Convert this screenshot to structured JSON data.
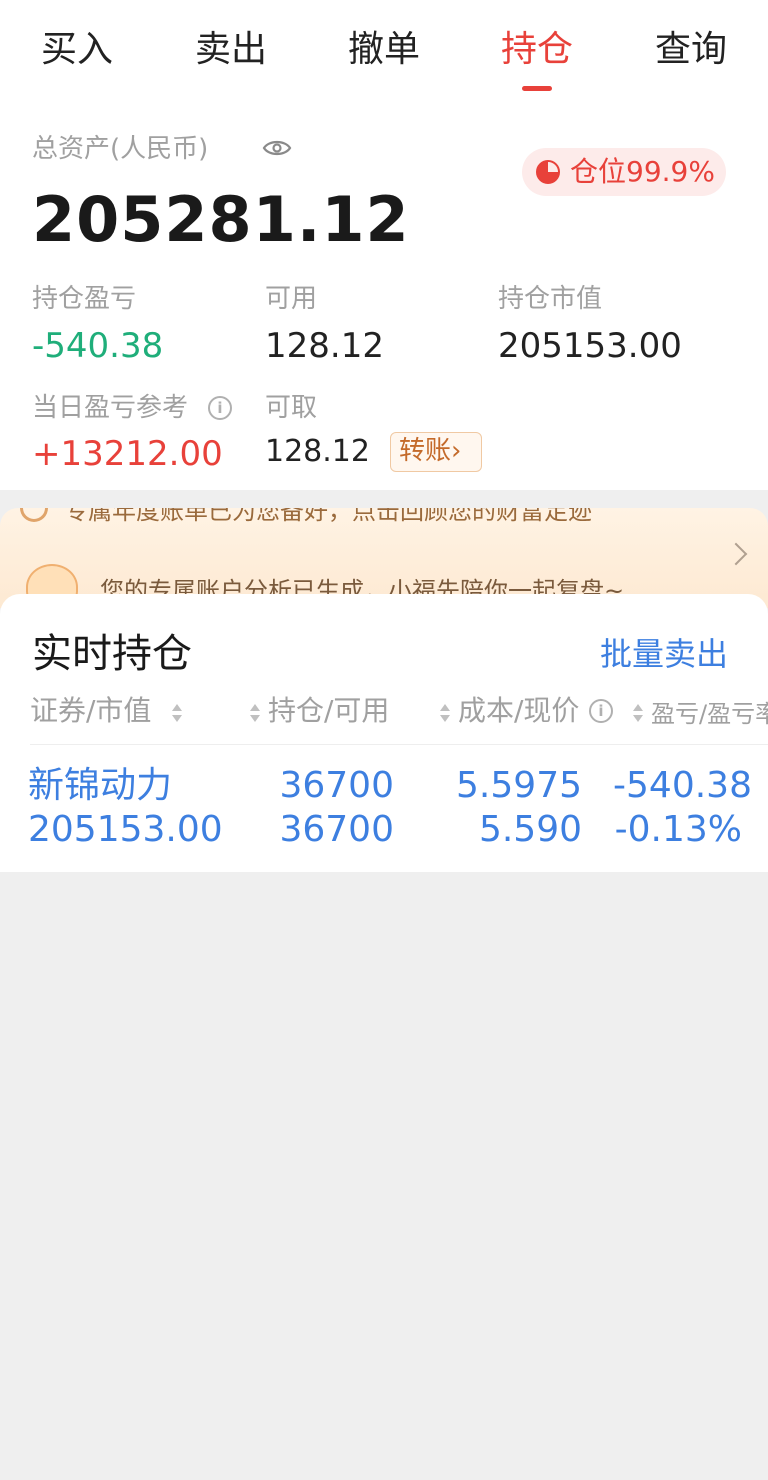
{
  "tabs": [
    {
      "label": "买入"
    },
    {
      "label": "卖出"
    },
    {
      "label": "撤单"
    },
    {
      "label": "持仓",
      "active": true
    },
    {
      "label": "查询"
    }
  ],
  "summary": {
    "total_assets_label": "总资产(人民币)",
    "total_assets_value": "205281.12",
    "position_ratio_label": "仓位99.9%",
    "holding_pl_label": "持仓盈亏",
    "holding_pl_value": "-540.38",
    "available_label": "可用",
    "available_value": "128.12",
    "market_value_label": "持仓市值",
    "market_value_value": "205153.00",
    "daily_pl_label": "当日盈亏参考",
    "daily_pl_value": "+13212.00",
    "withdrawable_label": "可取",
    "withdrawable_value": "128.12",
    "transfer_label": "转账"
  },
  "banner": {
    "line1": "专属年度账单已为您备好，点击回顾您的财富足迹",
    "line2": "您的专属账户分析已生成，小福先陪你一起复盘~"
  },
  "positions": {
    "title": "实时持仓",
    "bulk_sell_label": "批量卖出",
    "headers": [
      "证券/市值",
      "持仓/可用",
      "成本/现价",
      "盈亏/盈亏率"
    ],
    "rows": [
      {
        "name": "新锦动力",
        "market_value": "205153.00",
        "holding": "36700",
        "available": "36700",
        "cost": "5.5975",
        "price": "5.590",
        "pl": "-540.38",
        "pl_rate": "-0.13%"
      }
    ]
  },
  "colors": {
    "accent_red": "#e8413a",
    "gain_red": "#e8413a",
    "loss_green": "#1fae7a",
    "link_blue": "#3d7fe0"
  }
}
